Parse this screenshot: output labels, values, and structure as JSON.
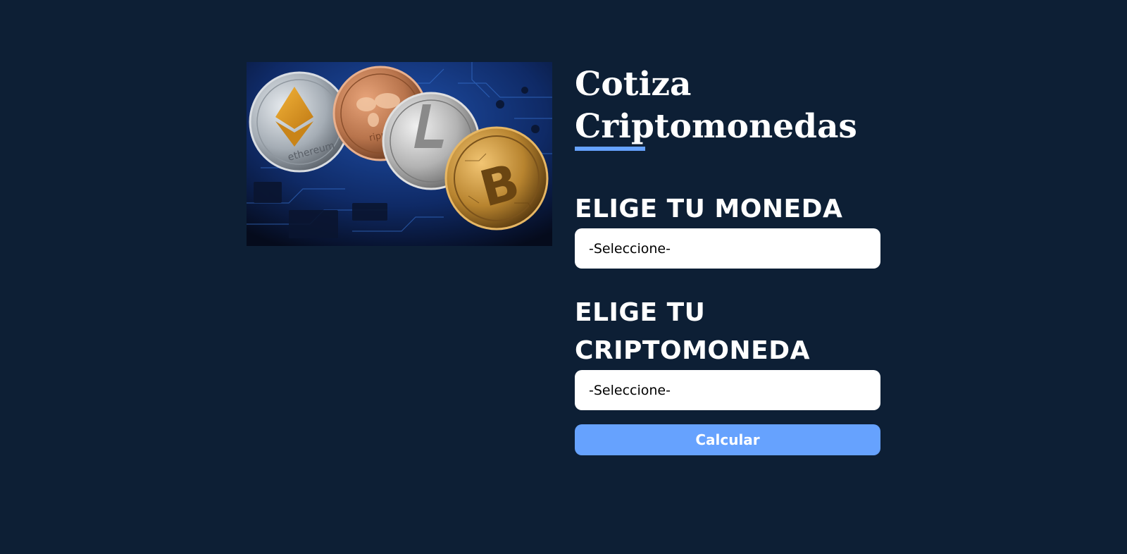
{
  "header": {
    "title": "Cotiza Criptomonedas",
    "accent_color": "#66a2fe"
  },
  "hero": {
    "image_icon": "crypto-coins-image"
  },
  "form": {
    "currency_label": "ELIGE TU MONEDA",
    "currency_selected": "-Seleccione-",
    "crypto_label": "ELIGE TU CRIPTOMONEDA",
    "crypto_selected": "-Seleccione-",
    "submit_label": "Calcular"
  },
  "theme": {
    "background": "#0d1f35",
    "button": "#66a2fe",
    "input_background": "#ffffff"
  }
}
